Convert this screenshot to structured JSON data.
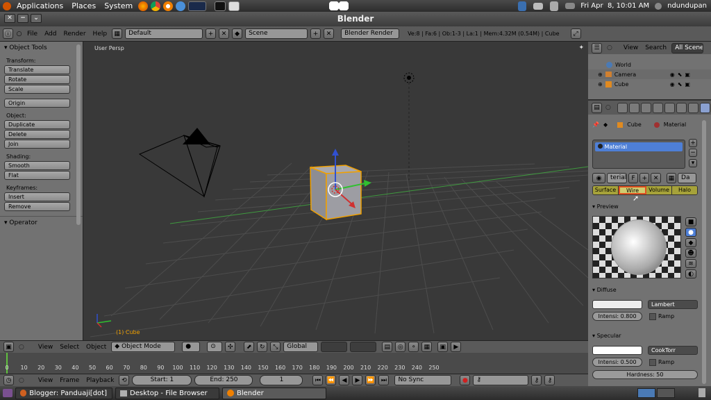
{
  "gnome_panel": {
    "menus": [
      "Applications",
      "Places",
      "System"
    ],
    "datetime": "Fri Apr  8, 10:01 AM",
    "user": "ndundupan"
  },
  "window": {
    "title": "Blender"
  },
  "info_header": {
    "menus": [
      "File",
      "Add",
      "Render",
      "Help"
    ],
    "screen_layout": "Default",
    "scene": "Scene",
    "render_engine": "Blender Render",
    "stats": "Ve:8 | Fa:6 | Ob:1-3 | La:1 | Mem:4.32M (0.54M) | Cube"
  },
  "tool_shelf": {
    "title": "Object Tools",
    "sections": [
      {
        "label": "Transform:",
        "buttons": [
          "Translate",
          "Rotate",
          "Scale"
        ]
      },
      {
        "label": "",
        "buttons": [
          "Origin"
        ]
      },
      {
        "label": "Object:",
        "buttons": [
          "Duplicate",
          "Delete",
          "Join"
        ]
      },
      {
        "label": "Shading:",
        "buttons": [
          "Smooth",
          "Flat"
        ]
      },
      {
        "label": "Keyframes:",
        "buttons": [
          "Insert",
          "Remove"
        ]
      }
    ],
    "operator_title": "Operator"
  },
  "viewport": {
    "view_label": "User Persp",
    "object_label": "(1) Cube"
  },
  "viewport_header": {
    "menus": [
      "View",
      "Select",
      "Object"
    ],
    "mode": "Object Mode",
    "orientation": "Global"
  },
  "timeline": {
    "frames": [
      "0",
      "10",
      "20",
      "30",
      "40",
      "50",
      "60",
      "70",
      "80",
      "90",
      "100",
      "110",
      "120",
      "130",
      "140",
      "150",
      "160",
      "170",
      "180",
      "190",
      "200",
      "210",
      "220",
      "230",
      "240",
      "250"
    ]
  },
  "timeline_header": {
    "menus": [
      "View",
      "Frame",
      "Playback"
    ],
    "start": "Start: 1",
    "end": "End: 250",
    "current": "1",
    "sync": "No Sync"
  },
  "outliner_header": {
    "menus": [
      "View",
      "Search"
    ],
    "filter": "All Scenes"
  },
  "outliner": {
    "items": [
      "World",
      "Camera",
      "Cube"
    ]
  },
  "properties": {
    "breadcrumb_object": "Cube",
    "breadcrumb_material": "Material",
    "material_slot": "Material",
    "material_name": "terial",
    "f_label": "F",
    "data_link": "Da",
    "tabs": [
      "Surface",
      "Wire",
      "Volume",
      "Halo"
    ],
    "preview_title": "Preview",
    "diffuse_title": "Diffuse",
    "diffuse_shader": "Lambert",
    "diffuse_intensity": "Intensi: 0.800",
    "ramp_label": "Ramp",
    "specular_title": "Specular",
    "specular_shader": "CookTorr",
    "specular_intensity": "Intensi: 0.500",
    "hardness": "Hardness: 50"
  },
  "taskbar": {
    "tasks": [
      "Blogger: Panduaji[dot]...",
      "Desktop - File Browser",
      "Blender"
    ]
  },
  "colors": {
    "accent_orange": "#f0a000",
    "selection_blue": "#4e7fd6",
    "active_tab_highlight": "#e05020",
    "tab_olive": "#a6a23a"
  }
}
